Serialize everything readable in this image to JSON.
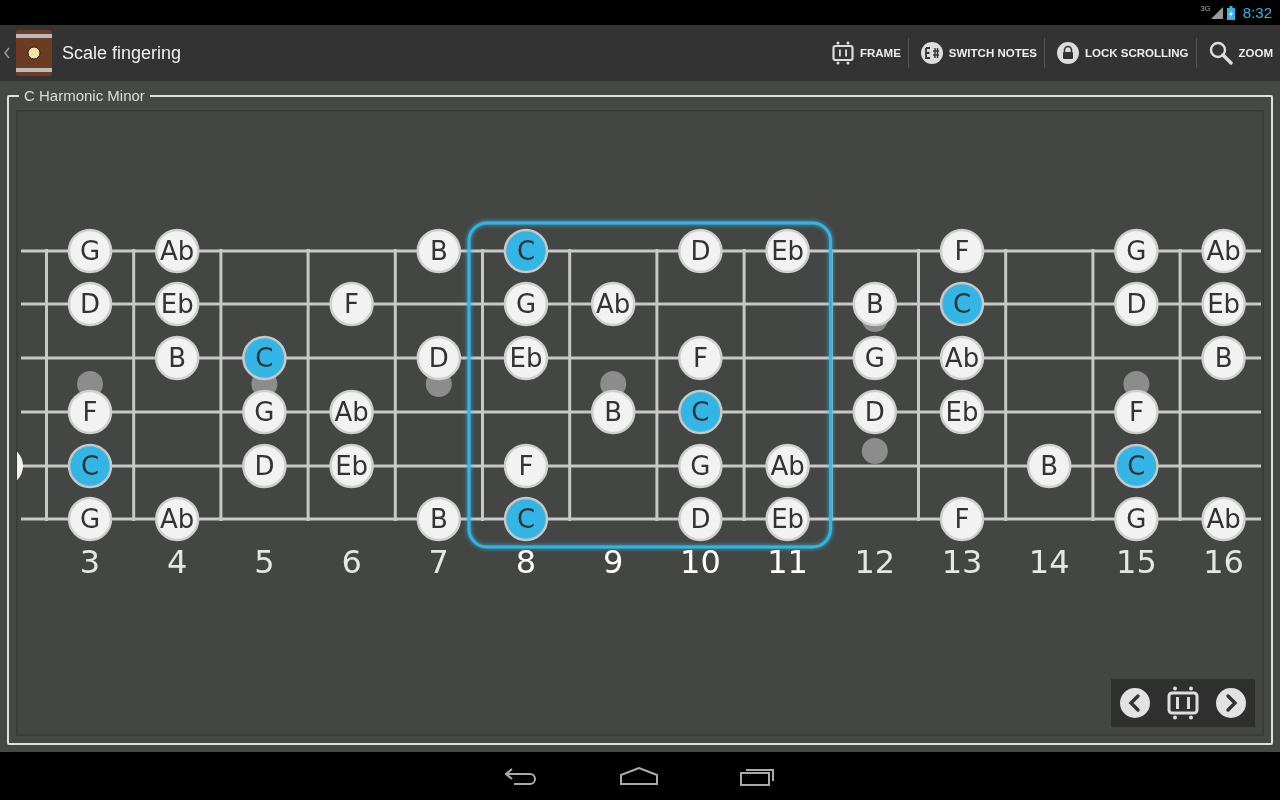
{
  "status_bar": {
    "network": "3G",
    "time": "8:32"
  },
  "action_bar": {
    "title": "Scale fingering",
    "actions": [
      {
        "kind": "frame",
        "label": "FRAME"
      },
      {
        "kind": "switch",
        "label": "SWITCH NOTES"
      },
      {
        "kind": "lock",
        "label": "LOCK SCROLLING"
      },
      {
        "kind": "zoom",
        "label": "ZOOM"
      }
    ]
  },
  "scale": {
    "title": "C Harmonic Minor"
  },
  "frets": [
    {
      "number": "3",
      "selected": false,
      "notes": [
        {
          "kind": "note",
          "note": "G"
        },
        {
          "kind": "note",
          "note": "D"
        },
        {
          "kind": "empty"
        },
        {
          "kind": "note",
          "note": "F"
        },
        {
          "kind": "root",
          "note": "C"
        },
        {
          "kind": "note",
          "note": "G"
        }
      ]
    },
    {
      "number": "4",
      "selected": false,
      "notes": [
        {
          "kind": "note",
          "note": "Ab"
        },
        {
          "kind": "note",
          "note": "Eb"
        },
        {
          "kind": "note",
          "note": "B"
        },
        {
          "kind": "empty"
        },
        {
          "kind": "empty"
        },
        {
          "kind": "note",
          "note": "Ab"
        }
      ]
    },
    {
      "number": "5",
      "selected": false,
      "notes": [
        {
          "kind": "empty"
        },
        {
          "kind": "empty"
        },
        {
          "kind": "root",
          "note": "C"
        },
        {
          "kind": "note",
          "note": "G"
        },
        {
          "kind": "note",
          "note": "D"
        },
        {
          "kind": "empty"
        }
      ]
    },
    {
      "number": "6",
      "selected": false,
      "notes": [
        {
          "kind": "empty"
        },
        {
          "kind": "note",
          "note": "F"
        },
        {
          "kind": "empty"
        },
        {
          "kind": "note",
          "note": "Ab"
        },
        {
          "kind": "note",
          "note": "Eb"
        },
        {
          "kind": "empty"
        }
      ]
    },
    {
      "number": "7",
      "selected": false,
      "notes": [
        {
          "kind": "note",
          "note": "B"
        },
        {
          "kind": "empty"
        },
        {
          "kind": "note",
          "note": "D"
        },
        {
          "kind": "empty"
        },
        {
          "kind": "empty"
        },
        {
          "kind": "note",
          "note": "B"
        }
      ]
    },
    {
      "number": "8",
      "selected": true,
      "notes": [
        {
          "kind": "root",
          "note": "C"
        },
        {
          "kind": "note",
          "note": "G"
        },
        {
          "kind": "note",
          "note": "Eb"
        },
        {
          "kind": "empty"
        },
        {
          "kind": "note",
          "note": "F"
        },
        {
          "kind": "root",
          "note": "C"
        }
      ]
    },
    {
      "number": "9",
      "selected": true,
      "notes": [
        {
          "kind": "empty"
        },
        {
          "kind": "note",
          "note": "Ab"
        },
        {
          "kind": "empty"
        },
        {
          "kind": "note",
          "note": "B"
        },
        {
          "kind": "empty"
        },
        {
          "kind": "empty"
        }
      ]
    },
    {
      "number": "10",
      "selected": true,
      "notes": [
        {
          "kind": "note",
          "note": "D"
        },
        {
          "kind": "empty"
        },
        {
          "kind": "note",
          "note": "F"
        },
        {
          "kind": "root",
          "note": "C"
        },
        {
          "kind": "note",
          "note": "G"
        },
        {
          "kind": "note",
          "note": "D"
        }
      ]
    },
    {
      "number": "11",
      "selected": true,
      "notes": [
        {
          "kind": "note",
          "note": "Eb"
        },
        {
          "kind": "empty"
        },
        {
          "kind": "empty"
        },
        {
          "kind": "empty"
        },
        {
          "kind": "note",
          "note": "Ab"
        },
        {
          "kind": "note",
          "note": "Eb"
        }
      ]
    },
    {
      "number": "12",
      "selected": false,
      "notes": [
        {
          "kind": "empty"
        },
        {
          "kind": "note",
          "note": "B"
        },
        {
          "kind": "note",
          "note": "G"
        },
        {
          "kind": "note",
          "note": "D"
        },
        {
          "kind": "empty"
        },
        {
          "kind": "empty"
        }
      ]
    },
    {
      "number": "13",
      "selected": false,
      "notes": [
        {
          "kind": "note",
          "note": "F"
        },
        {
          "kind": "root",
          "note": "C"
        },
        {
          "kind": "note",
          "note": "Ab"
        },
        {
          "kind": "note",
          "note": "Eb"
        },
        {
          "kind": "empty"
        },
        {
          "kind": "note",
          "note": "F"
        }
      ]
    },
    {
      "number": "14",
      "selected": false,
      "notes": [
        {
          "kind": "empty"
        },
        {
          "kind": "empty"
        },
        {
          "kind": "empty"
        },
        {
          "kind": "empty"
        },
        {
          "kind": "note",
          "note": "B"
        },
        {
          "kind": "empty"
        }
      ]
    },
    {
      "number": "15",
      "selected": false,
      "notes": [
        {
          "kind": "note",
          "note": "G"
        },
        {
          "kind": "note",
          "note": "D"
        },
        {
          "kind": "empty"
        },
        {
          "kind": "note",
          "note": "F"
        },
        {
          "kind": "root",
          "note": "C"
        },
        {
          "kind": "note",
          "note": "G"
        }
      ]
    },
    {
      "number": "16",
      "selected": false,
      "notes": [
        {
          "kind": "note",
          "note": "Ab"
        },
        {
          "kind": "note",
          "note": "Eb"
        },
        {
          "kind": "note",
          "note": "B"
        },
        {
          "kind": "empty"
        },
        {
          "kind": "empty"
        },
        {
          "kind": "note",
          "note": "Ab"
        }
      ]
    }
  ]
}
